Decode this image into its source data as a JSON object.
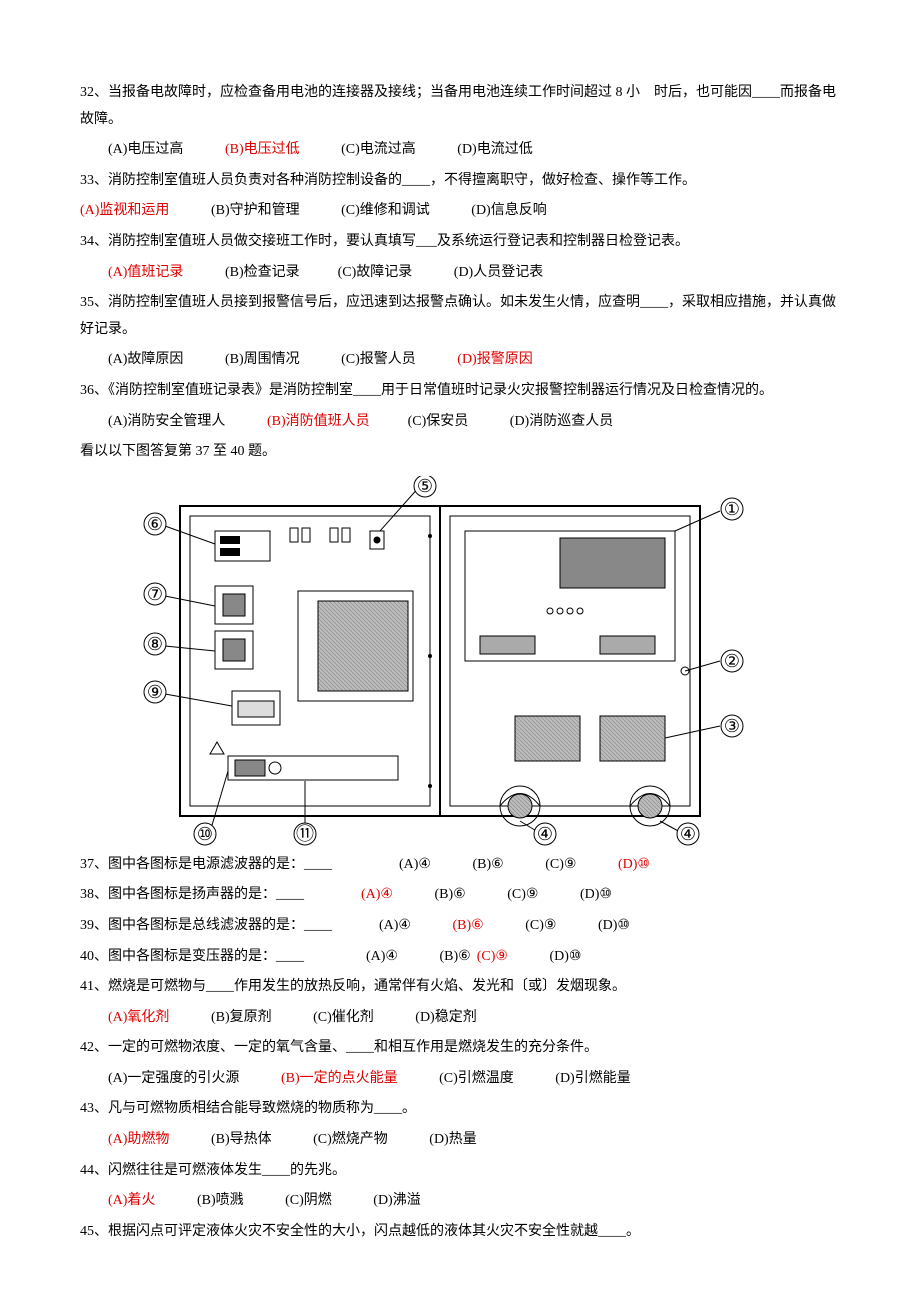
{
  "q32": {
    "text": "32、当报备电故障时，应检查备用电池的连接器及接线；当备用电池连续工作时间超过 8 小　时后，也可能因____而报备电故障。",
    "a": "(A)电压过高",
    "b": "(B)电压过低",
    "c": "(C)电流过高",
    "d": "(D)电流过低"
  },
  "q33": {
    "text": "33、消防控制室值班人员负责对各种消防控制设备的____，不得擅离职守，做好检查、操作等工作。",
    "a": "(A)监视和运用",
    "b": "(B)守护和管理",
    "c": "(C)维修和调试",
    "d": "(D)信息反响"
  },
  "q34": {
    "text": "34、消防控制室值班人员做交接班工作时，要认真填写___及系统运行登记表和控制器日检登记表。",
    "a": "(A)值班记录",
    "b": "(B)检查记录",
    "c": "(C)故障记录",
    "d": "(D)人员登记表"
  },
  "q35": {
    "text": "35、消防控制室值班人员接到报警信号后，应迅速到达报警点确认。如未发生火情，应查明____，采取相应措施，并认真做好记录。",
    "a": "(A)故障原因",
    "b": "(B)周围情况",
    "c": "(C)报警人员",
    "d": "(D)报警原因"
  },
  "q36": {
    "text": "36、《消防控制室值班记录表》是消防控制室____用于日常值班时记录火灾报警控制器运行情况及日检查情况的。",
    "a": "(A)消防安全管理人",
    "b": "(B)消防值班人员",
    "c": "(C)保安员",
    "d": "(D)消防巡查人员"
  },
  "fig_intro": "看以以下图答复第 37 至 40 题。",
  "labels": {
    "l1": "①",
    "l2": "②",
    "l3": "③",
    "l4": "④",
    "l5": "⑤",
    "l6": "⑥",
    "l7": "⑦",
    "l8": "⑧",
    "l9": "⑨",
    "l10": "⑩",
    "l11": "⑪"
  },
  "q37": {
    "text": "37、图中各图标是电源滤波器的是：____",
    "a": "(A)④",
    "b": "(B)⑥",
    "c": "(C)⑨",
    "d": "(D)⑩"
  },
  "q38": {
    "text": "38、图中各图标是扬声器的是：____",
    "a": "(A)④",
    "b": "(B)⑥",
    "c": "(C)⑨",
    "d": "(D)⑩"
  },
  "q39": {
    "text": "39、图中各图标是总线滤波器的是：____",
    "a": "(A)④",
    "b": "(B)⑥",
    "c": "(C)⑨",
    "d": "(D)⑩"
  },
  "q40": {
    "text": "40、图中各图标是变压器的是：____",
    "a": "(A)④",
    "b": "(B)⑥",
    "c": "(C)⑨",
    "d": "(D)⑩"
  },
  "q41": {
    "text": "41、燃烧是可燃物与____作用发生的放热反响，通常伴有火焰、发光和〔或〕发烟现象。",
    "a": "(A)氧化剂",
    "b": "(B)复原剂",
    "c": "(C)催化剂",
    "d": "(D)稳定剂"
  },
  "q42": {
    "text": "42、一定的可燃物浓度、一定的氧气含量、____和相互作用是燃烧发生的充分条件。",
    "a": "(A)一定强度的引火源",
    "b": "(B)一定的点火能量",
    "c": "(C)引燃温度",
    "d": "(D)引燃能量"
  },
  "q43": {
    "text": "43、凡与可燃物质相结合能导致燃烧的物质称为____。",
    "a": "(A)助燃物",
    "b": "(B)导热体",
    "c": "(C)燃烧产物",
    "d": "(D)热量"
  },
  "q44": {
    "text": "44、闪燃往往是可燃液体发生____的先兆。",
    "a": "(A)着火",
    "b": "(B)喷溅",
    "c": "(C)阴燃",
    "d": "(D)沸溢"
  },
  "q45": {
    "text": "45、根据闪点可评定液体火灾不安全性的大小，闪点越低的液体其火灾不安全性就越____。"
  }
}
